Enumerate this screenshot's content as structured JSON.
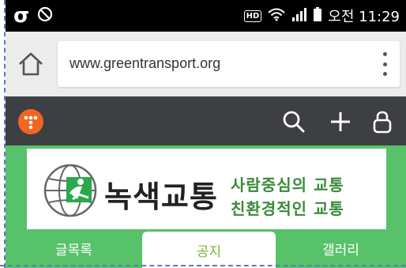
{
  "status_bar": {
    "left_icons": [
      "sigma-icon",
      "block-icon"
    ],
    "hd_label": "HD",
    "time": "오전 11:29"
  },
  "browser": {
    "url": "www.greentransport.org",
    "home_icon": "home-icon",
    "menu_icon": "more-vert-icon"
  },
  "site_header": {
    "logo_icon": "t-logo-icon",
    "actions": [
      "search-icon",
      "plus-icon",
      "lock-icon"
    ]
  },
  "banner": {
    "brand_name": "녹색교통",
    "tagline_line1": "사람중심의 교통",
    "tagline_line2": "친환경적인 교통"
  },
  "tabs": [
    {
      "label": "글목록",
      "active": false
    },
    {
      "label": "공지",
      "active": true
    },
    {
      "label": "갤러리",
      "active": false
    }
  ],
  "colors": {
    "green": "#58c26a",
    "dark_bar": "#3d3f43",
    "logo_orange": "#f26522",
    "active_tab_text": "#7ab53c"
  }
}
